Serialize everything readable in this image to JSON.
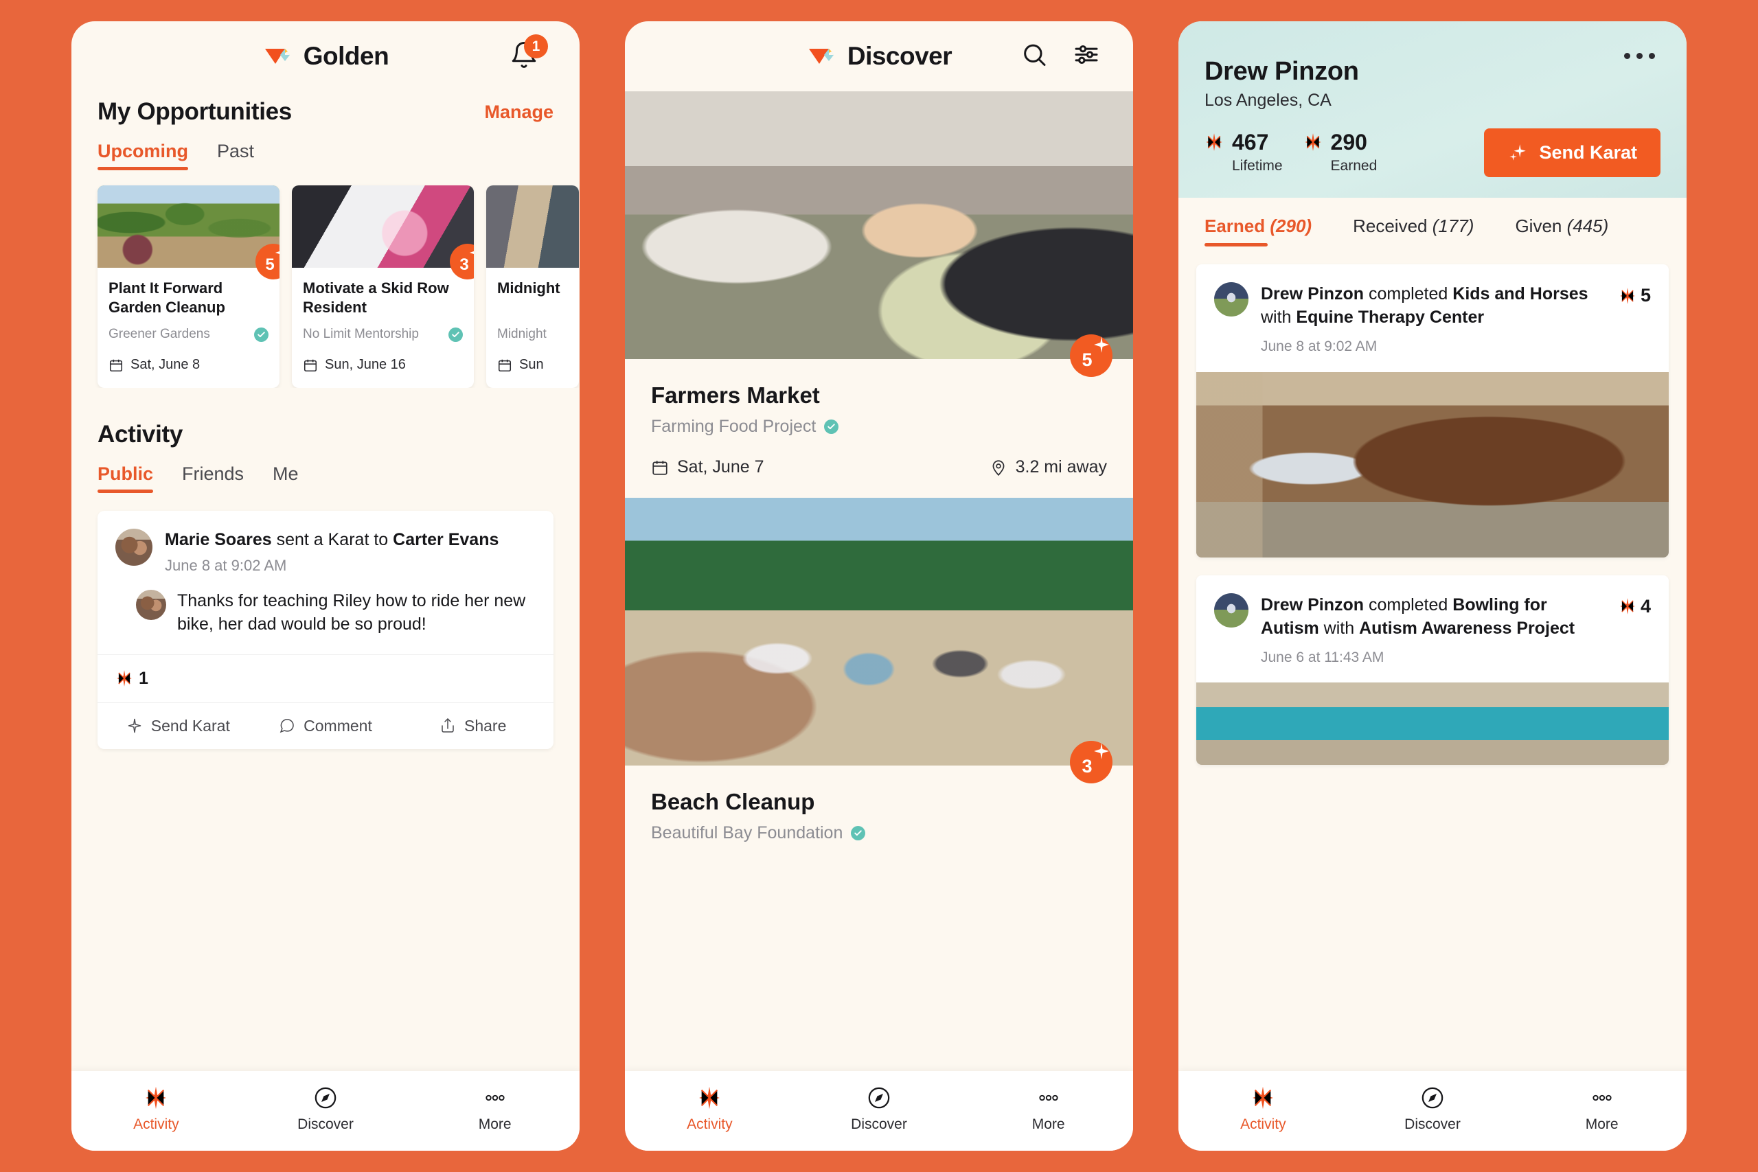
{
  "brand": {
    "name": "Golden",
    "logo_icon": "golden-triangle-logo"
  },
  "colors": {
    "accent": "#E8582A",
    "badge": "#F25B22",
    "page_bg": "#E8663C",
    "card_bg": "#FDF8F0",
    "verified": "#5FC2B4",
    "profile_hero": "#CFE9E6"
  },
  "phone1": {
    "header": {
      "title": "Golden",
      "bell_icon": "bell-icon",
      "notification_count": "1"
    },
    "opportunities": {
      "heading": "My Opportunities",
      "manage_label": "Manage",
      "tabs": [
        {
          "label": "Upcoming",
          "active": true
        },
        {
          "label": "Past",
          "active": false
        }
      ],
      "cards": [
        {
          "title": "Plant It Forward Garden Cleanup",
          "org": "Greener Gardens",
          "verified": true,
          "date": "Sat, June 8",
          "karats": "5",
          "photo": "garden-volunteers"
        },
        {
          "title": "Motivate a Skid Row Resident",
          "org": "No Limit Mentorship",
          "verified": true,
          "date": "Sun, June 16",
          "karats": "3",
          "photo": "event-volunteers"
        },
        {
          "title": "Midnight",
          "org": "Midnight",
          "verified": false,
          "date": "Sun",
          "karats": "",
          "photo": "midnight-volunteers"
        }
      ]
    },
    "activity": {
      "heading": "Activity",
      "tabs": [
        {
          "label": "Public",
          "active": true
        },
        {
          "label": "Friends",
          "active": false
        },
        {
          "label": "Me",
          "active": false
        }
      ],
      "post": {
        "actor": "Marie Soares",
        "verb": " sent a Karat to ",
        "recipient": "Carter Evans",
        "time": "June 8 at 9:02 AM",
        "comment": "Thanks for teaching Riley how to ride her new bike, her dad would be so proud!",
        "karat_count": "1",
        "actions": [
          {
            "label": "Send Karat",
            "icon": "sparkle-icon"
          },
          {
            "label": "Comment",
            "icon": "comment-bubble-icon"
          },
          {
            "label": "Share",
            "icon": "share-icon"
          }
        ]
      }
    },
    "nav": [
      {
        "label": "Activity",
        "icon": "sparkle-icon",
        "active": true
      },
      {
        "label": "Discover",
        "icon": "compass-icon",
        "active": false
      },
      {
        "label": "More",
        "icon": "ellipsis-icon",
        "active": false
      }
    ]
  },
  "phone2": {
    "header": {
      "title": "Discover",
      "search_icon": "search-icon",
      "filter_icon": "sliders-filter-icon"
    },
    "cards": [
      {
        "title": "Farmers Market",
        "org": "Farming Food Project",
        "verified": true,
        "date": "Sat, June 7",
        "distance": "3.2 mi away",
        "karats": "5",
        "photo": "farmers-market"
      },
      {
        "title": "Beach Cleanup",
        "org": "Beautiful Bay Foundation",
        "verified": true,
        "date": "",
        "distance": "",
        "karats": "3",
        "photo": "beach-cleanup"
      }
    ],
    "nav": [
      {
        "label": "Activity",
        "icon": "sparkle-icon",
        "active": true
      },
      {
        "label": "Discover",
        "icon": "compass-icon",
        "active": false
      },
      {
        "label": "More",
        "icon": "ellipsis-icon",
        "active": false
      }
    ]
  },
  "phone3": {
    "profile": {
      "name": "Drew Pinzon",
      "location": "Los Angeles, CA",
      "avatar_icon": "profile-avatar",
      "more_icon": "ellipsis-icon",
      "stats": [
        {
          "value": "467",
          "label": "Lifetime"
        },
        {
          "value": "290",
          "label": "Earned"
        }
      ],
      "send_karat_label": "Send Karat"
    },
    "tabs": [
      {
        "label": "Earned",
        "count": "(290)",
        "active": true
      },
      {
        "label": "Received",
        "count": "(177)",
        "active": false
      },
      {
        "label": "Given",
        "count": "(445)",
        "active": false
      }
    ],
    "feed": [
      {
        "actor": "Drew Pinzon",
        "verb": " completed ",
        "activity": "Kids and Horses",
        "with": " with ",
        "org": "Equine Therapy Center",
        "time": "June 8 at 9:02 AM",
        "karats": "5",
        "photo": "horse-grooming"
      },
      {
        "actor": "Drew Pinzon",
        "verb": " completed ",
        "activity": "Bowling for Autism",
        "with": " with ",
        "org": "Autism Awareness Project",
        "time": "June 6 at 11:43 AM",
        "karats": "4",
        "photo": "bowling-lane"
      }
    ],
    "nav": [
      {
        "label": "Activity",
        "icon": "sparkle-icon",
        "active": true
      },
      {
        "label": "Discover",
        "icon": "compass-icon",
        "active": false
      },
      {
        "label": "More",
        "icon": "ellipsis-icon",
        "active": false
      }
    ]
  }
}
